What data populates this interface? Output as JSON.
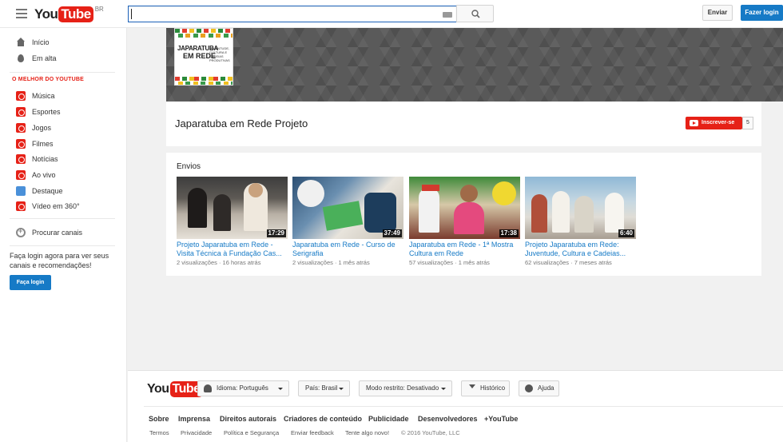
{
  "masthead": {
    "logo_you": "You",
    "logo_tube": "Tube",
    "logo_country": "BR",
    "search_value": "",
    "upload_label": "Enviar",
    "login_label": "Fazer login"
  },
  "guide": {
    "top_items": [
      {
        "label": "Início",
        "icon": "home-icon"
      },
      {
        "label": "Em alta",
        "icon": "flame-icon"
      }
    ],
    "section_title": "O MELHOR DO YOUTUBE",
    "best_items": [
      {
        "label": "Música",
        "icon": "music-icon"
      },
      {
        "label": "Esportes",
        "icon": "sports-icon"
      },
      {
        "label": "Jogos",
        "icon": "gaming-icon"
      },
      {
        "label": "Filmes",
        "icon": "film-icon"
      },
      {
        "label": "Notícias",
        "icon": "news-icon"
      },
      {
        "label": "Ao vivo",
        "icon": "live-icon"
      },
      {
        "label": "Destaque",
        "icon": "spotlight-icon"
      },
      {
        "label": "Vídeo em 360°",
        "icon": "360-icon"
      }
    ],
    "browse_channels": "Procurar canais",
    "login_prompt": "Faça login agora para ver seus canais e recomendações!",
    "login_button": "Faça login"
  },
  "channel": {
    "avatar_text_1": "JAPARATUBA",
    "avatar_text_2": "EM REDE",
    "avatar_text_3": "JUVENTUDE, CULTURA E CADEIAS PRODUTIVAS",
    "title": "Japaratuba em Rede Projeto",
    "subscribe_label": "Inscrever-se",
    "subscriber_count": "5"
  },
  "uploads": {
    "section_title": "Envios",
    "videos": [
      {
        "title": "Projeto Japaratuba em Rede - Visita Técnica à Fundação Cas...",
        "duration": "17:29",
        "views": "2 visualizações",
        "age": "16 horas atrás",
        "colors": [
          "#4a4a4a",
          "#b8b0a5",
          "#2e2a28"
        ]
      },
      {
        "title": "Japaratuba em Rede - Curso de Serigrafia",
        "duration": "37:49",
        "views": "2 visualizações",
        "age": "1 mês atrás",
        "colors": [
          "#1d3d5c",
          "#e8e4dc",
          "#3a6e9e"
        ]
      },
      {
        "title": "Japaratuba em Rede - 1ª Mostra Cultura em Rede",
        "duration": "17:38",
        "views": "57 visualizações",
        "age": "1 mês atrás",
        "colors": [
          "#7a3b2e",
          "#d6c8a8",
          "#3f8a3a"
        ]
      },
      {
        "title": "Projeto Japaratuba em Rede: Juventude, Cultura e Cadeias...",
        "duration": "6:40",
        "views": "62 visualizações",
        "age": "7 meses atrás",
        "colors": [
          "#8fb8d6",
          "#e0ddd6",
          "#b04f3a"
        ]
      }
    ]
  },
  "footer": {
    "logo_you": "You",
    "logo_tube": "Tube",
    "language_label": "Idioma: Português",
    "country_label": "País: Brasil",
    "restricted_label": "Modo restrito: Desativado",
    "history_label": "Histórico",
    "help_label": "Ajuda",
    "primary_links": [
      "Sobre",
      "Imprensa",
      "Direitos autorais",
      "Criadores de conteúdo",
      "Publicidade",
      "Desenvolvedores",
      "+YouTube"
    ],
    "secondary_links": [
      "Termos",
      "Privacidade",
      "Política e Segurança",
      "Enviar feedback",
      "Tente algo novo!",
      "© 2016 YouTube, LLC"
    ]
  }
}
